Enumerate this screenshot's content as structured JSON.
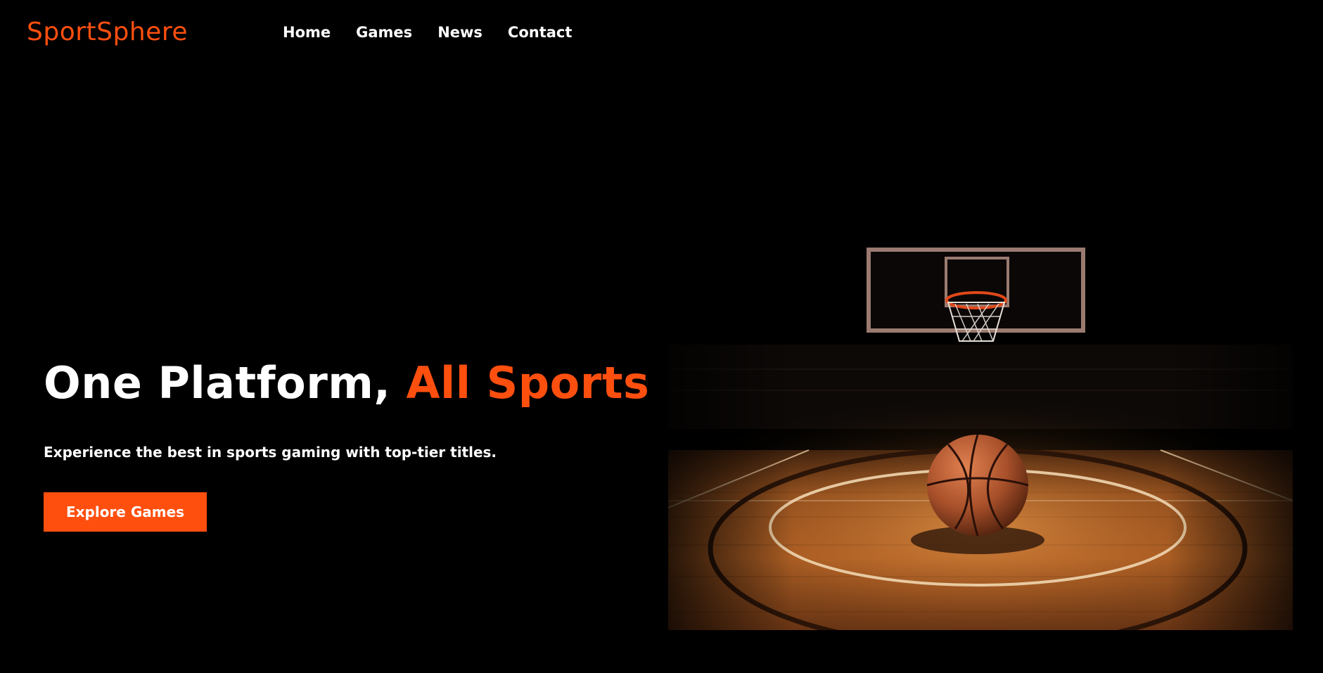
{
  "brand": {
    "name": "SportSphere"
  },
  "nav": {
    "items": [
      {
        "label": "Home"
      },
      {
        "label": "Games"
      },
      {
        "label": "News"
      },
      {
        "label": "Contact"
      }
    ]
  },
  "hero": {
    "title_main": "One Platform, ",
    "title_accent": "All Sports",
    "subtitle": "Experience the best in sports gaming with top-tier titles.",
    "cta_label": "Explore Games",
    "image_subject": "basketball on court under hoop"
  },
  "colors": {
    "background": "#000000",
    "accent": "#ff4f0f",
    "text": "#ffffff",
    "court_wood": "#a65a22"
  }
}
